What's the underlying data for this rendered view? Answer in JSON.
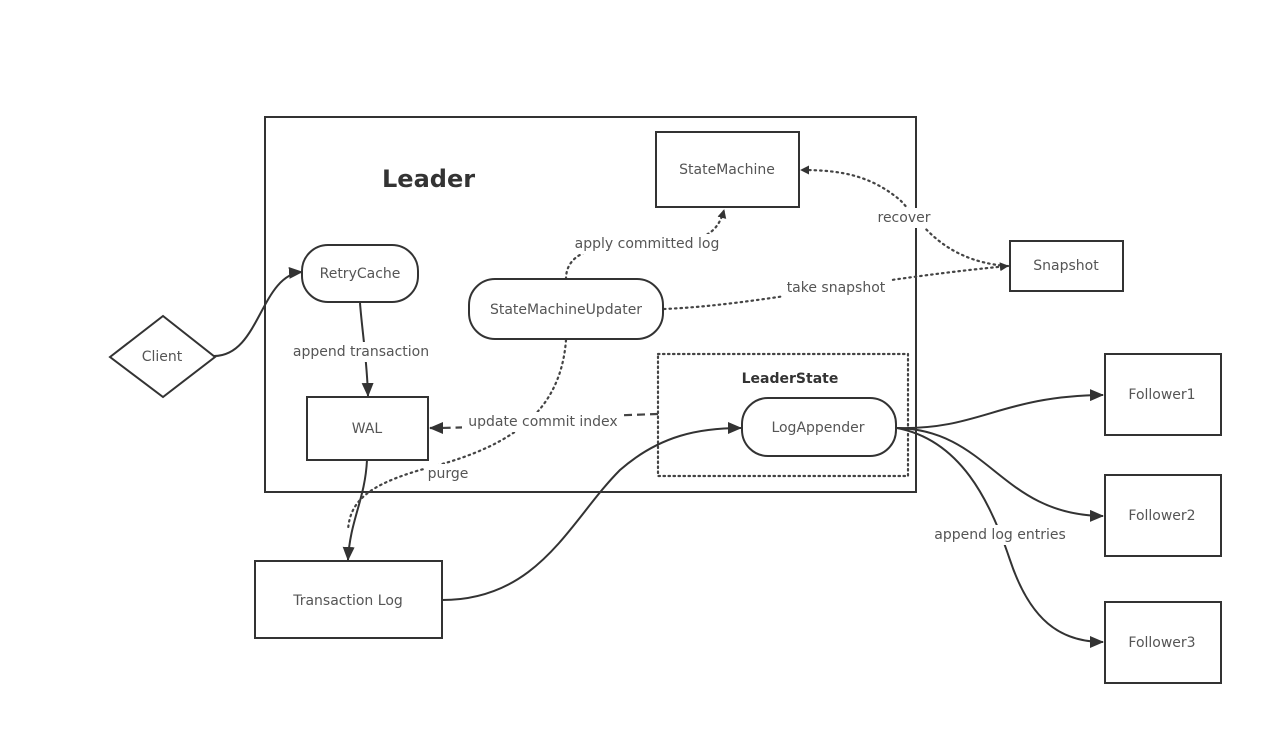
{
  "diagram": {
    "containers": {
      "leader": {
        "title": "Leader"
      },
      "leader_state": {
        "title": "LeaderState"
      }
    },
    "nodes": {
      "client": "Client",
      "retry_cache": "RetryCache",
      "wal": "WAL",
      "state_machine": "StateMachine",
      "state_machine_updater": "StateMachineUpdater",
      "snapshot": "Snapshot",
      "log_appender": "LogAppender",
      "transaction_log": "Transaction Log",
      "follower1": "Follower1",
      "follower2": "Follower2",
      "follower3": "Follower3"
    },
    "edges": {
      "append_transaction": "append transaction",
      "apply_committed_log": "apply committed log",
      "recover": "recover",
      "take_snapshot": "take snapshot",
      "update_commit_index": "update commit index",
      "purge": "purge",
      "append_log_entries": "append log entries"
    },
    "colors": {
      "stroke": "#333333",
      "text": "#555555",
      "background": "#ffffff"
    }
  }
}
